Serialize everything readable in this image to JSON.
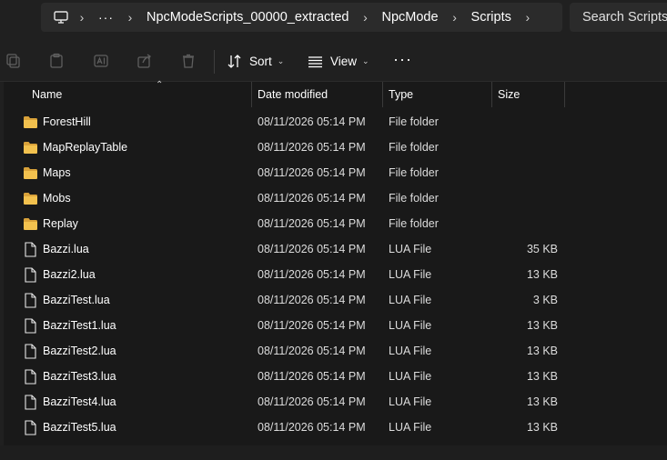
{
  "address": {
    "crumbs": [
      "NpcModeScripts_00000_extracted",
      "NpcMode",
      "Scripts"
    ],
    "ellipsis": "···",
    "search_placeholder": "Search Scripts"
  },
  "commands": {
    "sort_label": "Sort",
    "view_label": "View",
    "more_label": "···"
  },
  "columns": {
    "name": "Name",
    "date": "Date modified",
    "type": "Type",
    "size": "Size"
  },
  "items": [
    {
      "name": "ForestHill",
      "date": "08/11/2026 05:14 PM",
      "type": "File folder",
      "size": "",
      "kind": "folder"
    },
    {
      "name": "MapReplayTable",
      "date": "08/11/2026 05:14 PM",
      "type": "File folder",
      "size": "",
      "kind": "folder"
    },
    {
      "name": "Maps",
      "date": "08/11/2026 05:14 PM",
      "type": "File folder",
      "size": "",
      "kind": "folder"
    },
    {
      "name": "Mobs",
      "date": "08/11/2026 05:14 PM",
      "type": "File folder",
      "size": "",
      "kind": "folder"
    },
    {
      "name": "Replay",
      "date": "08/11/2026 05:14 PM",
      "type": "File folder",
      "size": "",
      "kind": "folder"
    },
    {
      "name": "Bazzi.lua",
      "date": "08/11/2026 05:14 PM",
      "type": "LUA File",
      "size": "35 KB",
      "kind": "file"
    },
    {
      "name": "Bazzi2.lua",
      "date": "08/11/2026 05:14 PM",
      "type": "LUA File",
      "size": "13 KB",
      "kind": "file"
    },
    {
      "name": "BazziTest.lua",
      "date": "08/11/2026 05:14 PM",
      "type": "LUA File",
      "size": "3 KB",
      "kind": "file"
    },
    {
      "name": "BazziTest1.lua",
      "date": "08/11/2026 05:14 PM",
      "type": "LUA File",
      "size": "13 KB",
      "kind": "file"
    },
    {
      "name": "BazziTest2.lua",
      "date": "08/11/2026 05:14 PM",
      "type": "LUA File",
      "size": "13 KB",
      "kind": "file"
    },
    {
      "name": "BazziTest3.lua",
      "date": "08/11/2026 05:14 PM",
      "type": "LUA File",
      "size": "13 KB",
      "kind": "file"
    },
    {
      "name": "BazziTest4.lua",
      "date": "08/11/2026 05:14 PM",
      "type": "LUA File",
      "size": "13 KB",
      "kind": "file"
    },
    {
      "name": "BazziTest5.lua",
      "date": "08/11/2026 05:14 PM",
      "type": "LUA File",
      "size": "13 KB",
      "kind": "file"
    }
  ],
  "colors": {
    "folder": "#f2c14e",
    "folder_dark": "#d9a23a",
    "accent_text": "#ffffff",
    "muted_icon": "#5f5f5f"
  }
}
